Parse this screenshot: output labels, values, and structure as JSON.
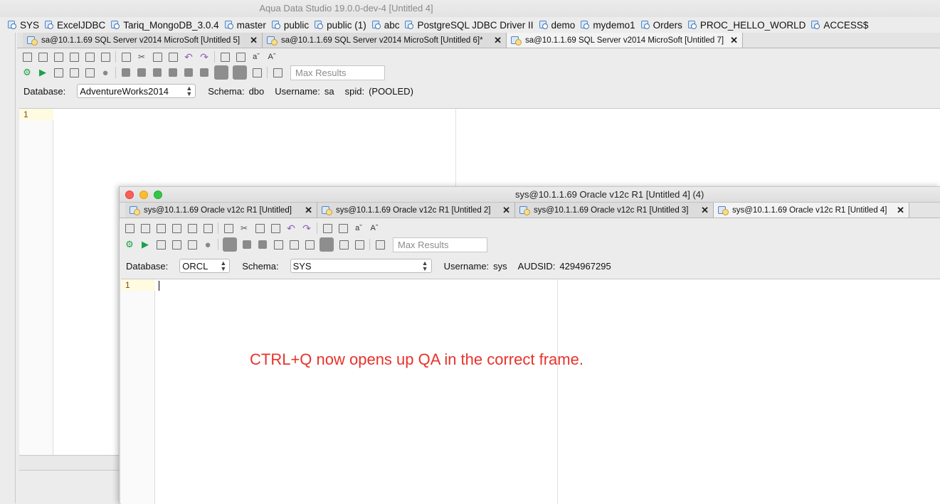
{
  "app": {
    "title": "Aqua Data Studio 19.0.0-dev-4 [Untitled 4]"
  },
  "bookmarks": [
    "SYS",
    "ExcelJDBC",
    "Tariq_MongoDB_3.0.4",
    "master",
    "public",
    "public (1)",
    "abc",
    "PostgreSQL JDBC Driver II",
    "demo",
    "mydemo1",
    "Orders",
    "PROC_HELLO_WORLD",
    "ACCESS$"
  ],
  "main_window": {
    "tabs": [
      {
        "label": "sa@10.1.1.69 SQL Server v2014 MicroSoft [Untitled 5]",
        "active": false
      },
      {
        "label": "sa@10.1.1.69 SQL Server v2014 MicroSoft [Untitled 6]*",
        "active": false
      },
      {
        "label": "sa@10.1.1.69 SQL Server v2014 MicroSoft [Untitled 7]",
        "active": true
      }
    ],
    "max_results_placeholder": "Max Results",
    "info": {
      "database_label": "Database:",
      "database_value": "AdventureWorks2014",
      "schema_label": "Schema:",
      "schema_value": "dbo",
      "username_label": "Username:",
      "username_value": "sa",
      "spid_label": "spid:",
      "spid_value": "(POOLED)"
    },
    "line_number": "1"
  },
  "oracle_window": {
    "title": "sys@10.1.1.69 Oracle  v12c R1 [Untitled 4] (4)",
    "tabs": [
      {
        "label": "sys@10.1.1.69 Oracle  v12c R1 [Untitled]",
        "active": false
      },
      {
        "label": "sys@10.1.1.69 Oracle  v12c R1 [Untitled 2]",
        "active": false
      },
      {
        "label": "sys@10.1.1.69 Oracle  v12c R1 [Untitled 3]",
        "active": false
      },
      {
        "label": "sys@10.1.1.69 Oracle  v12c R1 [Untitled 4]",
        "active": true
      }
    ],
    "max_results_placeholder": "Max Results",
    "info": {
      "database_label": "Database:",
      "database_value": "ORCL",
      "schema_label": "Schema:",
      "schema_value": "SYS",
      "username_label": "Username:",
      "username_value": "sys",
      "audsid_label": "AUDSID:",
      "audsid_value": "4294967295"
    },
    "line_number": "1"
  },
  "annotation": {
    "text": "CTRL+Q now opens up QA in the correct frame.",
    "color": "#e8322a"
  },
  "colors": {
    "traffic_close": "#fc5f57",
    "traffic_min": "#fdbc2e",
    "traffic_max": "#33c748"
  }
}
